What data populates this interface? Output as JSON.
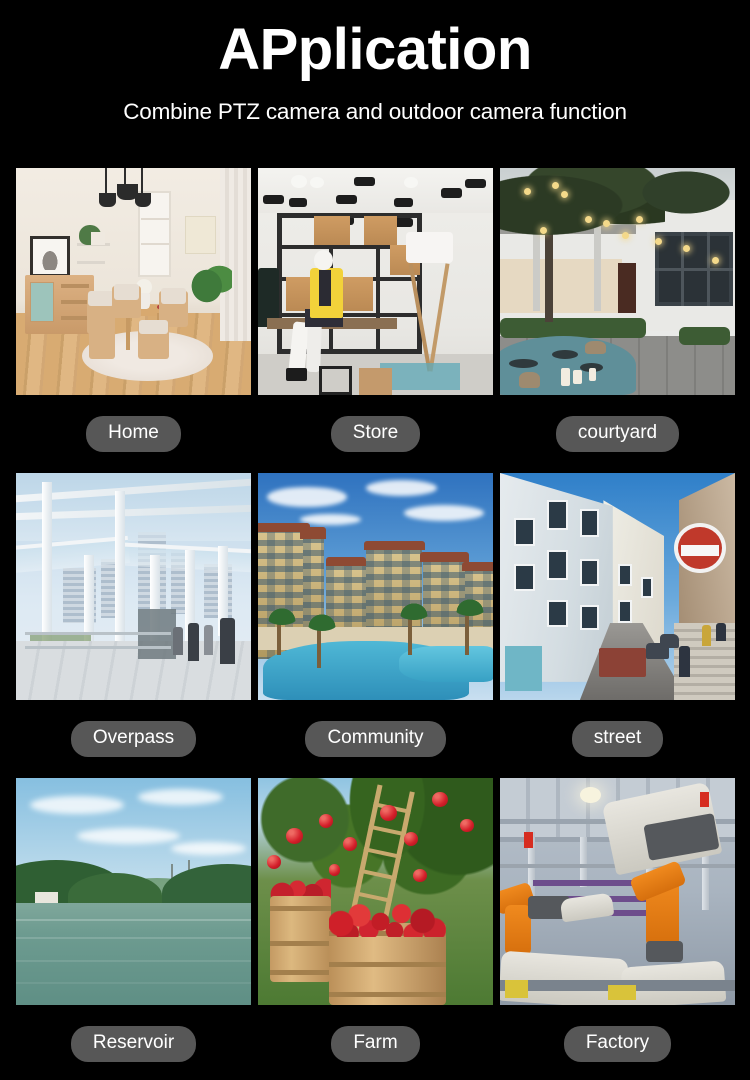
{
  "header": {
    "title": "APplication",
    "subtitle": "Combine PTZ camera and outdoor camera function"
  },
  "theme": {
    "background": "#000000",
    "text": "#ffffff",
    "pill_background": "#575757",
    "pill_text": "#ffffff"
  },
  "gallery": {
    "rows": [
      [
        {
          "label": "Home",
          "scene": "home-interior-dining-room"
        },
        {
          "label": "Store",
          "scene": "retail-store-mannequin"
        },
        {
          "label": "courtyard",
          "scene": "outdoor-courtyard-string-lights"
        }
      ],
      [
        {
          "label": "Overpass",
          "scene": "elevated-glass-walkway"
        },
        {
          "label": "Community",
          "scene": "residential-complex-pool"
        },
        {
          "label": "street",
          "scene": "narrow-european-street"
        }
      ],
      [
        {
          "label": "Reservoir",
          "scene": "lake-reservoir-green-hills"
        },
        {
          "label": "Farm",
          "scene": "apple-orchard-barrels"
        },
        {
          "label": "Factory",
          "scene": "automotive-robot-assembly-line"
        }
      ]
    ]
  }
}
